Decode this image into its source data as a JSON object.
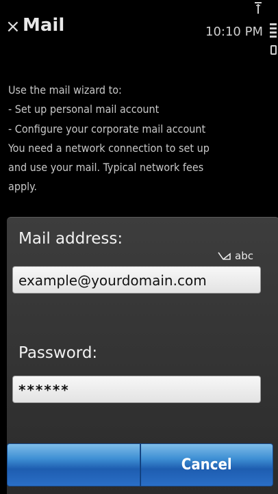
{
  "header": {
    "close_glyph": "×",
    "title": "Mail",
    "time": "10:10 PM"
  },
  "info_lines": [
    "Use the mail wizard to:",
    "- Set up personal mail account",
    "- Configure your corporate mail account",
    "You need a network connection to set up",
    "and use your mail. Typical network fees",
    "apply."
  ],
  "dialog": {
    "mail_label": "Mail address:",
    "input_mode": "abc",
    "mail_value": "example@yourdomain.com",
    "password_label": "Password:",
    "password_value": "******",
    "left_button_label": "",
    "cancel_label": "Cancel"
  },
  "colors": {
    "background": "#000000",
    "dialog": "#333333",
    "button_blue": "#2a6fc7"
  }
}
